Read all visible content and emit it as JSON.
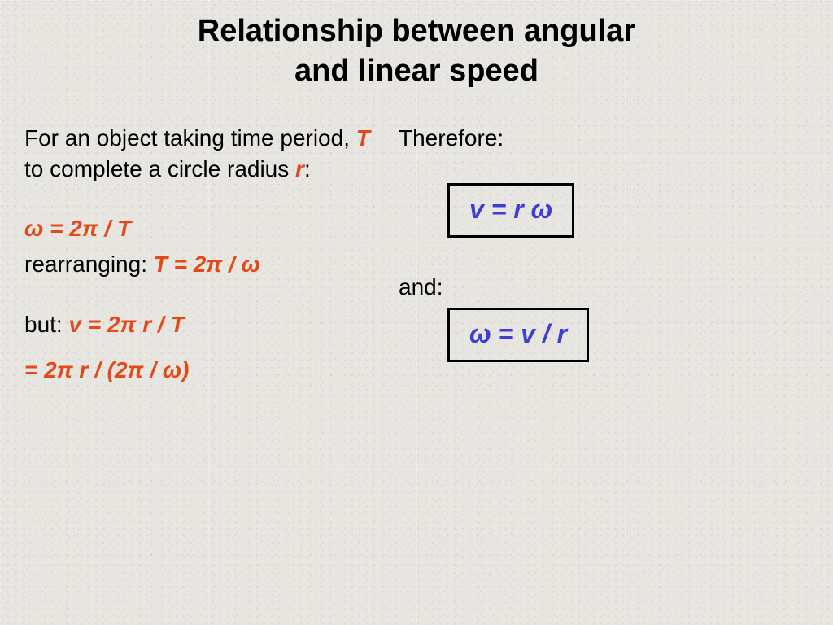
{
  "title": {
    "line1": "Relationship between angular",
    "line2": "and linear speed"
  },
  "left": {
    "intro_a": "For an object taking time period, ",
    "intro_T": "T",
    "intro_b": " to complete a circle radius ",
    "intro_r": "r",
    "intro_c": ":",
    "eq_omega": "ω = 2π / T",
    "rearranging_a": "rearranging: ",
    "rearranging_eq": "T = 2π / ω",
    "but_a": "but: ",
    "but_eq": "v = 2π r  / T",
    "subst_eq": "= 2π r  / (2π / ω)"
  },
  "right": {
    "therefore": "Therefore:",
    "box1": "v = r ω",
    "and_label": "and:",
    "box2": "ω  =  v / r"
  },
  "colors": {
    "accent": "#e24a1a",
    "formula": "#3f3fcf"
  }
}
